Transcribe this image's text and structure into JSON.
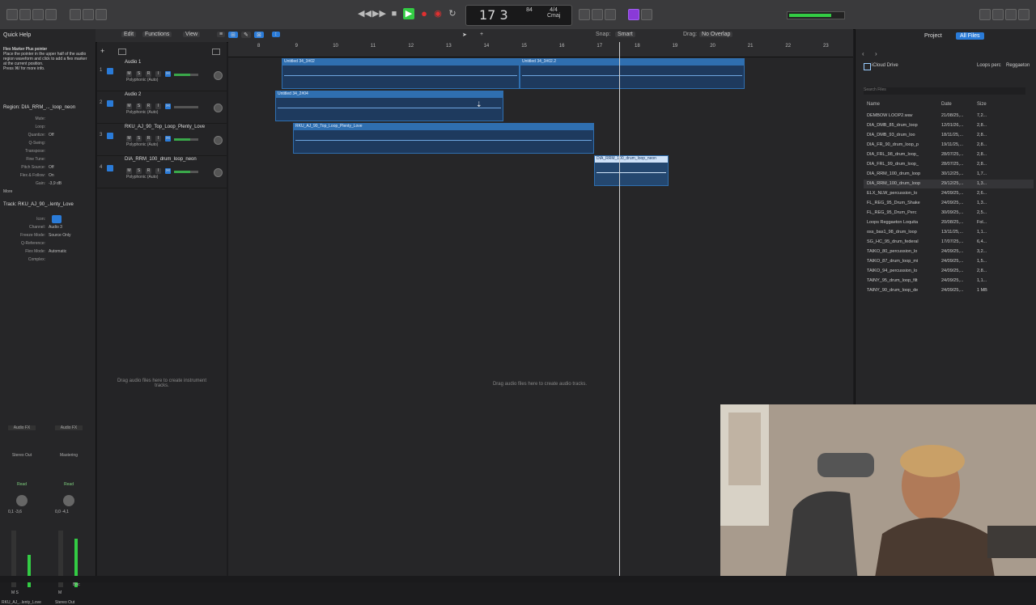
{
  "transport": {
    "position": "17  3",
    "bpm": "84",
    "bpm_label": "",
    "time_signature": "4/4",
    "key": "Cmaj",
    "play_icon": "play-icon",
    "record_icon": "record-icon"
  },
  "quick_help": {
    "title": "Quick Help",
    "heading": "Flex Marker Plus pointer",
    "body": "Place the pointer in the upper half of the audio region waveform and click to add a flex marker at the current position.",
    "more": "Press ⌘/ for more info."
  },
  "region_inspector": {
    "title": "Region: DIA_RRM_..._loop_neon",
    "rows": [
      {
        "k": "Mute:",
        "v": ""
      },
      {
        "k": "Loop:",
        "v": ""
      },
      {
        "k": "Quantize:",
        "v": "Off"
      },
      {
        "k": "Q-Swing:",
        "v": ""
      },
      {
        "k": "Transpose:",
        "v": ""
      },
      {
        "k": "Fine Tune:",
        "v": ""
      },
      {
        "k": "Pitch Source:",
        "v": "Off"
      },
      {
        "k": "Flex & Follow:",
        "v": "On"
      },
      {
        "k": "Gain:",
        "v": "-3,9 dB"
      }
    ],
    "more": "More"
  },
  "track_inspector": {
    "title": "Track: RKU_AJ_90_..lenty_Love",
    "rows": [
      {
        "k": "Icon:",
        "v": ""
      },
      {
        "k": "Channel:",
        "v": "Audio 3"
      },
      {
        "k": "Freeze Mode:",
        "v": "Source Only"
      },
      {
        "k": "Q-Reference:",
        "v": ""
      },
      {
        "k": "Flex Mode:",
        "v": "Automatic"
      },
      {
        "k": "Complex:",
        "v": ""
      }
    ]
  },
  "toolbar": {
    "edit": "Edit",
    "functions": "Functions",
    "view": "View",
    "snap_label": "Snap:",
    "snap_value": "Smart",
    "drag_label": "Drag:",
    "drag_value": "No Overlap"
  },
  "tracks": [
    {
      "num": "1",
      "name": "Audio 1",
      "sub": "Polyphonic (Auto)"
    },
    {
      "num": "2",
      "name": "Audio 2",
      "sub": "Polyphonic (Auto)"
    },
    {
      "num": "3",
      "name": "RKU_AJ_90_Top_Loop_Plenty_Love",
      "sub": "Polyphonic (Auto)"
    },
    {
      "num": "4",
      "name": "DIA_RRM_100_drum_loop_neon",
      "sub": "Polyphonic (Auto)"
    }
  ],
  "ruler": [
    "8",
    "9",
    "10",
    "11",
    "12",
    "13",
    "14",
    "15",
    "16",
    "17",
    "18",
    "19",
    "20",
    "21",
    "22",
    "23"
  ],
  "regions": [
    {
      "label": "Untitled 34_3#02"
    },
    {
      "label": "Untitled 34_3#02.2"
    },
    {
      "label": "Untitled 34_2#04"
    },
    {
      "label": "RKU_AJ_90_Top_Loop_Plenty_Love"
    },
    {
      "label": "DIA_RRM_100_drum_loop_neon"
    }
  ],
  "hints": {
    "audio": "Drag audio files here to create audio tracks.",
    "instrument": "Drag audio files here to create instrument tracks."
  },
  "browser": {
    "tab_project": "Project",
    "tab_all": "All Files",
    "location": "iCloud Drive",
    "path_end": "Loops perc",
    "path_end2": "Reggaeton",
    "search_placeholder": "Search Files",
    "col_name": "Name",
    "col_date": "Date",
    "col_size": "Size",
    "files": [
      {
        "name": "DEMBOW LOOP2.wav",
        "date": "21/08/25,...",
        "size": "7,2..."
      },
      {
        "name": "DIA_DMB_85_drum_loop",
        "date": "12/01/26,...",
        "size": "2,8..."
      },
      {
        "name": "DIA_DMB_93_drum_loo",
        "date": "18/11/25,...",
        "size": "2,8..."
      },
      {
        "name": "DIA_FR_90_drum_loop_p",
        "date": "19/11/25,...",
        "size": "2,8..."
      },
      {
        "name": "DIA_FRL_98_drum_loop_",
        "date": "28/07/25,...",
        "size": "2,8..."
      },
      {
        "name": "DIA_FRL_99_drum_loop_",
        "date": "28/07/25,...",
        "size": "2,8..."
      },
      {
        "name": "DIA_RRM_100_drum_loop",
        "date": "30/12/25,...",
        "size": "1,7..."
      },
      {
        "name": "DIA_RRM_100_drum_loop",
        "date": "29/12/25,...",
        "size": "1,3..."
      },
      {
        "name": "ELX_NLW_percussion_lo",
        "date": "24/09/25,...",
        "size": "2,6..."
      },
      {
        "name": "FL_REG_95_Drum_Shake",
        "date": "24/09/25,...",
        "size": "1,3..."
      },
      {
        "name": "FL_REG_95_Drum_Perc",
        "date": "30/09/25,...",
        "size": "2,5..."
      },
      {
        "name": "Loops Reggaeton Loquita",
        "date": "20/08/25,...",
        "size": "Fol..."
      },
      {
        "name": "oss_bas1_98_drum_loop",
        "date": "13/11/25,...",
        "size": "1,1..."
      },
      {
        "name": "SG_HC_95_drum_federal",
        "date": "17/07/25,...",
        "size": "6,4..."
      },
      {
        "name": "TAIKO_80_percussion_lo",
        "date": "24/09/25,...",
        "size": "3,2..."
      },
      {
        "name": "TAIKO_87_drum_loop_mi",
        "date": "24/09/25,...",
        "size": "1,5..."
      },
      {
        "name": "TAIKO_94_percussion_lo",
        "date": "24/09/25,...",
        "size": "2,8..."
      },
      {
        "name": "TAINY_95_drum_loop_filt",
        "date": "24/09/25,...",
        "size": "1,1..."
      },
      {
        "name": "TAINY_90_drum_loop_de",
        "date": "24/09/25,...",
        "size": "1 MB"
      }
    ]
  },
  "mixer": {
    "strip1_name": "RKU_AJ_..lenty_Love",
    "strip2_name": "Stereo Out",
    "strip1_io": "Audio FX",
    "strip2_io": "Audio FX",
    "strip1_out": "Stereo Out",
    "strip2_out": "Mastering",
    "strip1_mode": "Read",
    "strip2_mode": "Read",
    "strip1_vals": "0,1  -3,6",
    "strip2_vals": "0,0  -4,1",
    "strip1_ms": "M  S",
    "strip2_ms": "M",
    "strip2_bnc": "Bnc"
  },
  "colors": {
    "region": "#2f6fb0",
    "play": "#33cc44",
    "record": "#e03030",
    "accent": "#2a7bd8"
  }
}
